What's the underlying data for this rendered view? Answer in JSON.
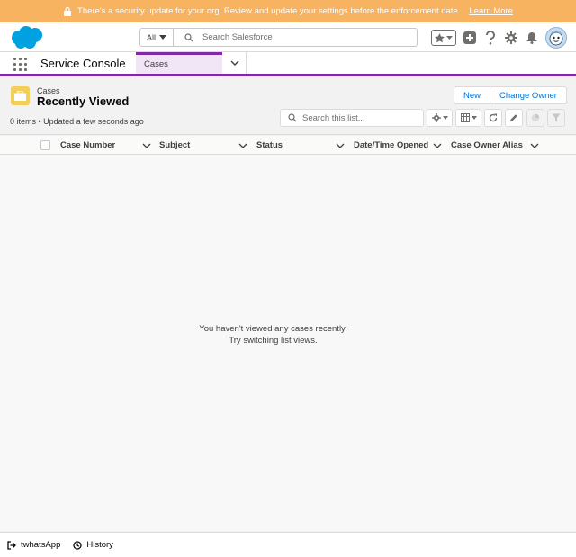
{
  "banner": {
    "message": "There's a security update for your org. Review and update your settings before the enforcement date.",
    "link": "Learn More",
    "icon": "lock-icon"
  },
  "global": {
    "logo": "salesforce-logo",
    "scope": "All",
    "search_placeholder": "Search Salesforce",
    "icons": [
      "favorites-star-icon",
      "add-icon",
      "help-icon",
      "setup-gear-icon",
      "notifications-bell-icon",
      "user-avatar"
    ]
  },
  "nav": {
    "app_name": "Service Console",
    "tab_label": "Cases",
    "icons": [
      "app-launcher-icon",
      "chevron-down-icon"
    ]
  },
  "list": {
    "object_name": "Cases",
    "view_name": "Recently Viewed",
    "meta": "0 items • Updated a few seconds ago",
    "buttons": {
      "new": "New",
      "change_owner": "Change Owner"
    },
    "search_placeholder": "Search this list...",
    "tools": [
      "list-settings-gear-icon",
      "display-as-table-icon",
      "refresh-icon",
      "edit-icon",
      "chart-icon",
      "filter-icon"
    ]
  },
  "columns": [
    "Case Number",
    "Subject",
    "Status",
    "Date/Time Opened",
    "Case Owner Alias"
  ],
  "empty_state": {
    "line1": "You haven't viewed any cases recently.",
    "line2": "Try switching list views."
  },
  "footer": {
    "items": [
      {
        "label": "twhatsApp",
        "icon": "whatsapp-login-icon"
      },
      {
        "label": "History",
        "icon": "clock-icon"
      }
    ]
  },
  "colors": {
    "accent": "#8229a5",
    "link": "#0070d2",
    "banner": "#f7b35f",
    "cloud": "#00a1e0",
    "case_icon": "#f2cf5b"
  }
}
